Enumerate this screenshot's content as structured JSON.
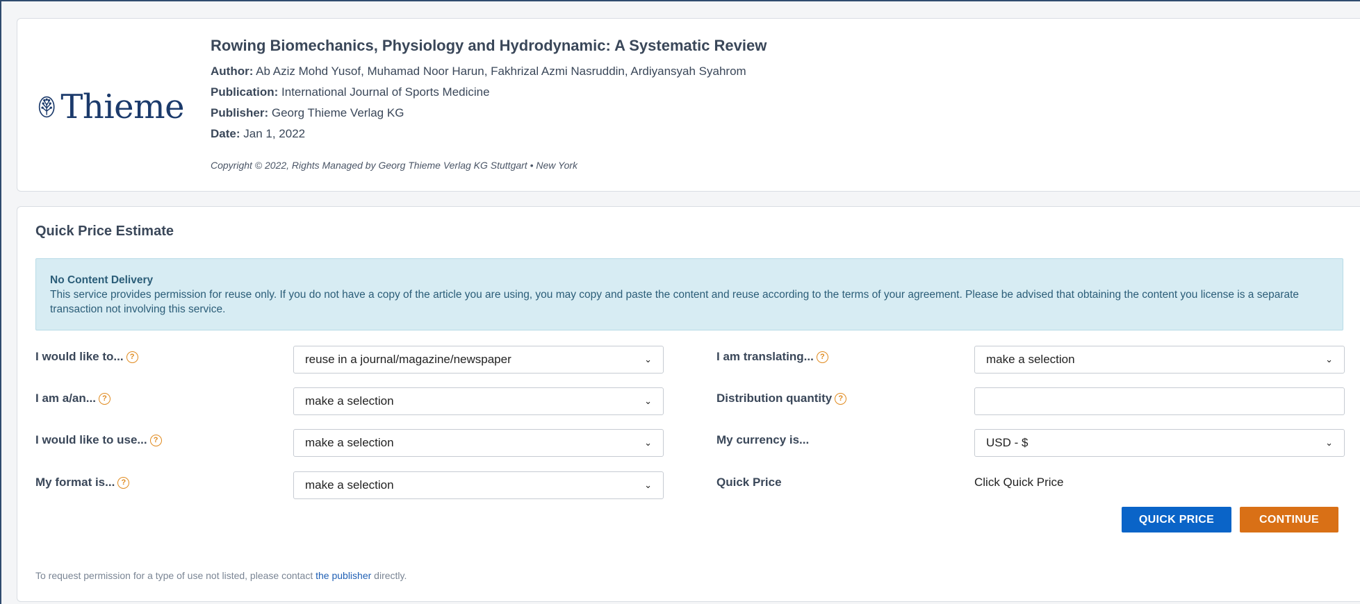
{
  "article": {
    "logo_text": "Thieme",
    "title": "Rowing Biomechanics, Physiology and Hydrodynamic: A Systematic Review",
    "author_label": "Author:",
    "author": "Ab Aziz Mohd Yusof, Muhamad Noor Harun, Fakhrizal Azmi Nasruddin, Ardiyansyah Syahrom",
    "publication_label": "Publication:",
    "publication": "International Journal of Sports Medicine",
    "publisher_label": "Publisher:",
    "publisher": "Georg Thieme Verlag KG",
    "date_label": "Date:",
    "date": "Jan 1, 2022",
    "copyright": "Copyright © 2022, Rights Managed by Georg Thieme Verlag KG Stuttgart • New York"
  },
  "quote": {
    "title": "Quick Price Estimate",
    "notice_title": "No Content Delivery",
    "notice_text": "This service provides permission for reuse only. If you do not have a copy of the article you are using, you may copy and paste the content and reuse according to the terms of your agreement. Please be advised that obtaining the content you license is a separate transaction not involving this service.",
    "fields": {
      "would_like_to": {
        "label": "I would like to...",
        "value": "reuse in a journal/magazine/newspaper"
      },
      "i_am": {
        "label": "I am a/an...",
        "value": "make a selection"
      },
      "would_like_to_use": {
        "label": "I would like to use...",
        "value": "make a selection"
      },
      "format": {
        "label": "My format is...",
        "value": "make a selection"
      },
      "translating": {
        "label": "I am translating...",
        "value": "make a selection"
      },
      "distribution": {
        "label": "Distribution quantity",
        "value": ""
      },
      "currency": {
        "label": "My currency is...",
        "value": "USD - $"
      },
      "quick_price": {
        "label": "Quick Price",
        "value": "Click Quick Price"
      }
    },
    "quick_price_button": "QUICK PRICE",
    "continue_button": "CONTINUE",
    "footnote_before": "To request permission for a type of use not listed, please contact ",
    "footnote_link": "the publisher",
    "footnote_after": " directly."
  }
}
